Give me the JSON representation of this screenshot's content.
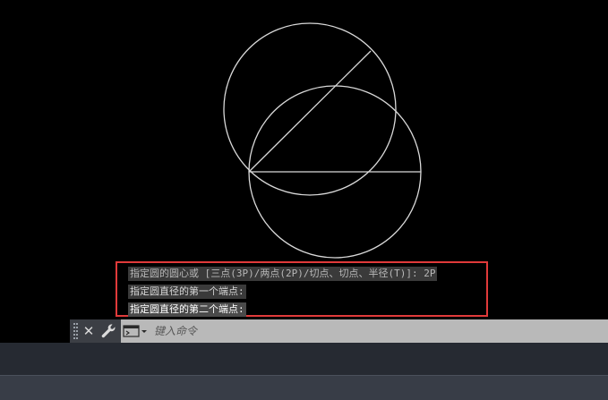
{
  "command_history": [
    "指定圆的圆心或 [三点(3P)/两点(2P)/切点、切点、半径(T)]: 2P",
    "指定圆直径的第一个端点:",
    "指定圆直径的第二个端点:"
  ],
  "command_line": {
    "placeholder": "键入命令",
    "close_icon": "close-icon",
    "customize_icon": "wrench-icon",
    "prompt_icon": "command-prompt-icon"
  },
  "colors": {
    "canvas_background": "#000000",
    "drawing_lines": "#d9d9d9",
    "highlight_border": "#e03a3a",
    "command_bar": "#b9b9b9"
  }
}
